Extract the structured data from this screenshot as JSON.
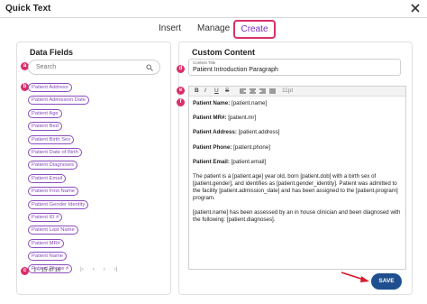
{
  "window": {
    "title": "Quick Text"
  },
  "tabs": [
    {
      "label": "Insert"
    },
    {
      "label": "Manage"
    },
    {
      "label": "Create"
    }
  ],
  "data_fields": {
    "heading": "Data Fields",
    "search_placeholder": "Search",
    "items": [
      {
        "label": "Patient Address"
      },
      {
        "label": "Patient Admission Date"
      },
      {
        "label": "Patient Age"
      },
      {
        "label": "Patient Bed"
      },
      {
        "label": "Patient Birth Sex"
      },
      {
        "label": "Patient Date of Birth"
      },
      {
        "label": "Patient Diagnoses"
      },
      {
        "label": "Patient Email"
      },
      {
        "label": "Patient First Name"
      },
      {
        "label": "Patient Gender Identity"
      },
      {
        "label": "Patient ID #"
      },
      {
        "label": "Patient Last Name"
      },
      {
        "label": "Patient MR#"
      },
      {
        "label": "Patient Name"
      },
      {
        "label": "Patient Phone #"
      }
    ],
    "pagination": "1 - 15 of 16",
    "pager_buttons": {
      "first": "|‹",
      "prev": "‹",
      "next": "›",
      "last": "›|"
    }
  },
  "custom_content": {
    "heading": "Custom Content",
    "title_field_label": "Content Title",
    "title_field_value": "Patient Introduction Paragraph",
    "toolbar": {
      "bold": "B",
      "italic": "I",
      "underline": "U",
      "strike": "S",
      "font_size": "11pt"
    },
    "content": {
      "name_label": "Patient Name:",
      "name_value": "[patient.name]",
      "mr_label": "Patient MR#:",
      "mr_value": "[patient.mr]",
      "address_label": "Patient Address:",
      "address_value": "[patient.address]",
      "phone_label": "Patient Phone:",
      "phone_value": "[patient.phone]",
      "email_label": "Patient Email:",
      "email_value": "[patient.email]",
      "paragraph1": "The patient is a [patient.age] year old, born [patient.dob] with a birth sex of [patient.gender], and identifies as [patient.gender_identity]. Patient was admitted to the facility [patient.admission_date] and has been assigned to the [patient.program] program.",
      "paragraph2": "[patient.name] has been assessed by an in house clinician and been diagnosed with the following: [patient.diagnoses]."
    },
    "save_label": "SAVE"
  },
  "badges": {
    "a": "a",
    "b": "b",
    "c": "c",
    "d": "d",
    "e": "e",
    "f": "f"
  },
  "colors": {
    "accent": "#d8306a",
    "chip": "#8a4bbd",
    "save": "#1f4f8f",
    "arrow": "#d81b2c"
  }
}
